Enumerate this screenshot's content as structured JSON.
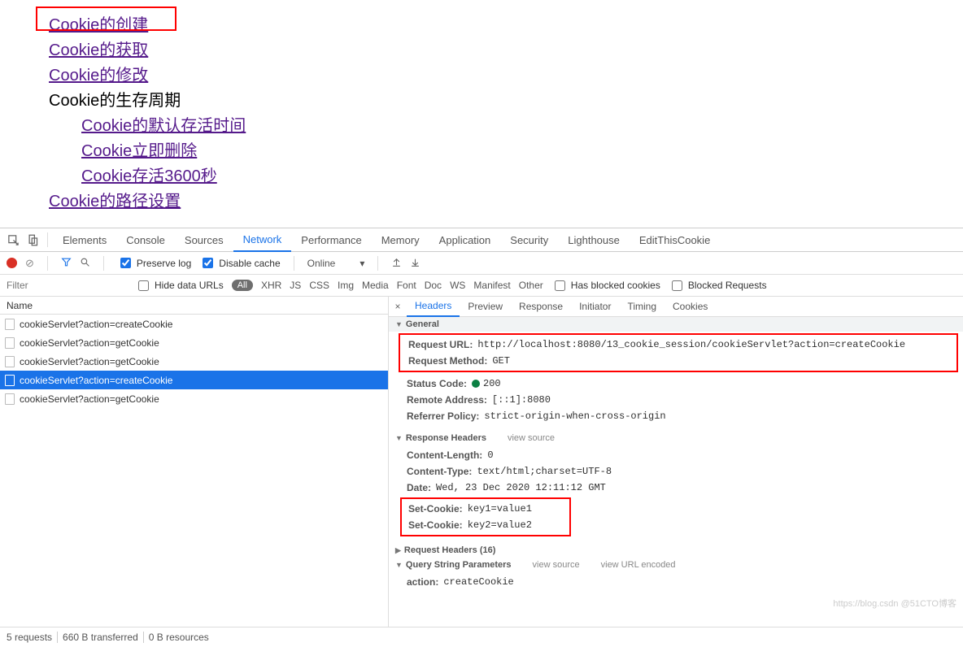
{
  "page": {
    "links": {
      "create": "Cookie的创建",
      "get": "Cookie的获取",
      "modify": "Cookie的修改",
      "life_header": "Cookie的生存周期",
      "default_life": "Cookie的默认存活时间",
      "delete_now": "Cookie立即删除",
      "live_3600": "Cookie存活3600秒",
      "path": "Cookie的路径设置"
    }
  },
  "devtools": {
    "tabs": [
      "Elements",
      "Console",
      "Sources",
      "Network",
      "Performance",
      "Memory",
      "Application",
      "Security",
      "Lighthouse",
      "EditThisCookie"
    ],
    "active_tab": "Network",
    "preserve_log_label": "Preserve log",
    "disable_cache_label": "Disable cache",
    "throttling": "Online",
    "filter_placeholder": "Filter",
    "hide_data_urls_label": "Hide data URLs",
    "all_chip": "All",
    "filter_types": [
      "XHR",
      "JS",
      "CSS",
      "Img",
      "Media",
      "Font",
      "Doc",
      "WS",
      "Manifest",
      "Other"
    ],
    "has_blocked_cookies_label": "Has blocked cookies",
    "blocked_requests_label": "Blocked Requests",
    "name_header": "Name",
    "requests": [
      "cookieServlet?action=createCookie",
      "cookieServlet?action=getCookie",
      "cookieServlet?action=getCookie",
      "cookieServlet?action=createCookie",
      "cookieServlet?action=getCookie"
    ],
    "selected_request_index": 3,
    "detail_tabs": [
      "Headers",
      "Preview",
      "Response",
      "Initiator",
      "Timing",
      "Cookies"
    ],
    "active_detail_tab": "Headers",
    "sections": {
      "general": "General",
      "response_headers": "Response Headers",
      "request_headers": "Request Headers (16)",
      "query_string": "Query String Parameters",
      "view_source": "view source",
      "view_url_encoded": "view URL encoded"
    },
    "general": {
      "request_url_k": "Request URL:",
      "request_url_v": "http://localhost:8080/13_cookie_session/cookieServlet?action=createCookie",
      "request_method_k": "Request Method:",
      "request_method_v": "GET",
      "status_code_k": "Status Code:",
      "status_code_v": "200",
      "remote_addr_k": "Remote Address:",
      "remote_addr_v": "[::1]:8080",
      "referrer_k": "Referrer Policy:",
      "referrer_v": "strict-origin-when-cross-origin"
    },
    "resp_headers": {
      "content_length_k": "Content-Length:",
      "content_length_v": "0",
      "content_type_k": "Content-Type:",
      "content_type_v": "text/html;charset=UTF-8",
      "date_k": "Date:",
      "date_v": "Wed, 23 Dec 2020 12:11:12 GMT",
      "set_cookie1_k": "Set-Cookie:",
      "set_cookie1_v": "key1=value1",
      "set_cookie2_k": "Set-Cookie:",
      "set_cookie2_v": "key2=value2"
    },
    "query": {
      "action_k": "action:",
      "action_v": "createCookie"
    }
  },
  "footer": {
    "requests": "5 requests",
    "transferred": "660 B transferred",
    "resources": "0 B resources"
  },
  "watermark": "https://blog.csdn  @51CTO博客"
}
